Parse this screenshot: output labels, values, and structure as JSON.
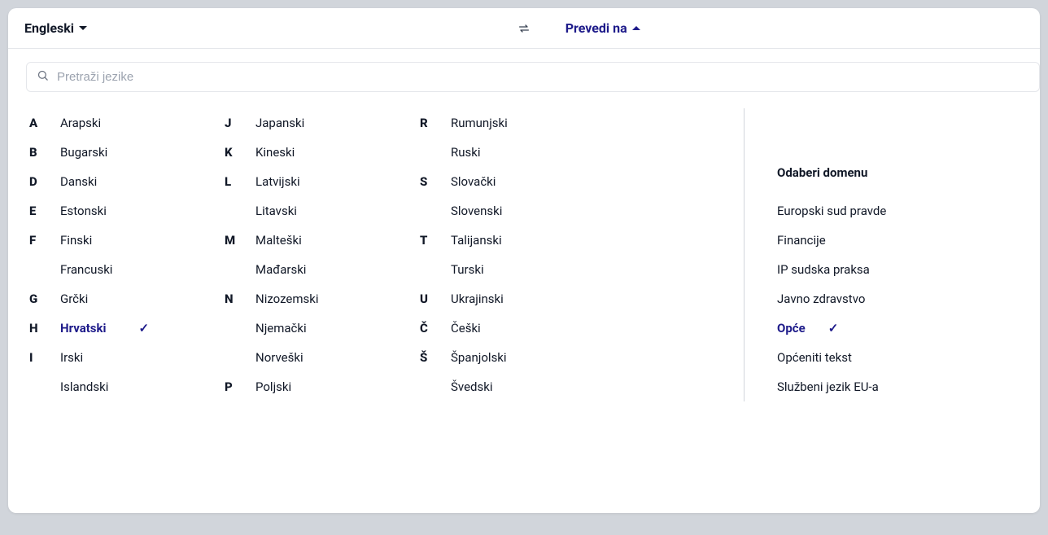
{
  "header": {
    "source_language": "Engleski",
    "target_label": "Prevedi na"
  },
  "search": {
    "placeholder": "Pretraži jezike"
  },
  "columns": [
    [
      {
        "letter": "A",
        "name": "Arapski"
      },
      {
        "letter": "B",
        "name": "Bugarski"
      },
      {
        "letter": "D",
        "name": "Danski"
      },
      {
        "letter": "E",
        "name": "Estonski"
      },
      {
        "letter": "F",
        "name": "Finski"
      },
      {
        "letter": "",
        "name": "Francuski"
      },
      {
        "letter": "G",
        "name": "Grčki"
      },
      {
        "letter": "H",
        "name": "Hrvatski",
        "selected": true
      },
      {
        "letter": "I",
        "name": "Irski"
      },
      {
        "letter": "",
        "name": "Islandski"
      }
    ],
    [
      {
        "letter": "J",
        "name": "Japanski"
      },
      {
        "letter": "K",
        "name": "Kineski"
      },
      {
        "letter": "L",
        "name": "Latvijski"
      },
      {
        "letter": "",
        "name": "Litavski"
      },
      {
        "letter": "M",
        "name": "Malteški"
      },
      {
        "letter": "",
        "name": "Mađarski"
      },
      {
        "letter": "N",
        "name": "Nizozemski"
      },
      {
        "letter": "",
        "name": "Njemački"
      },
      {
        "letter": "",
        "name": "Norveški"
      },
      {
        "letter": "P",
        "name": "Poljski"
      }
    ],
    [
      {
        "letter": "R",
        "name": "Rumunjski"
      },
      {
        "letter": "",
        "name": "Ruski"
      },
      {
        "letter": "S",
        "name": "Slovački"
      },
      {
        "letter": "",
        "name": "Slovenski"
      },
      {
        "letter": "T",
        "name": "Talijanski"
      },
      {
        "letter": "",
        "name": "Turski"
      },
      {
        "letter": "U",
        "name": "Ukrajinski"
      },
      {
        "letter": "Č",
        "name": "Češki"
      },
      {
        "letter": "Š",
        "name": "Španjolski"
      },
      {
        "letter": "",
        "name": "Švedski"
      }
    ]
  ],
  "domain": {
    "title": "Odaberi domenu",
    "items": [
      {
        "name": "Europski sud pravde"
      },
      {
        "name": "Financije"
      },
      {
        "name": "IP sudska praksa"
      },
      {
        "name": "Javno zdravstvo"
      },
      {
        "name": "Opće",
        "selected": true
      },
      {
        "name": "Općeniti tekst"
      },
      {
        "name": "Službeni jezik EU-a"
      }
    ]
  },
  "check_glyph": "✓"
}
